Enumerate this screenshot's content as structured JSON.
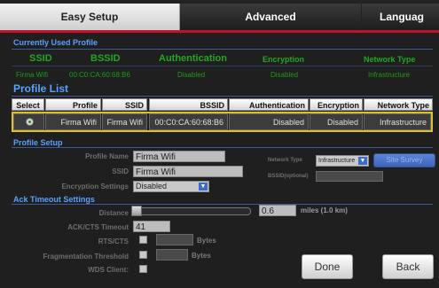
{
  "tabs": {
    "easy": "Easy Setup",
    "advanced": "Advanced",
    "language": "Languag"
  },
  "current": {
    "title": "Currently Used Profile",
    "headers": [
      "SSID",
      "BSSID",
      "Authentication",
      "Encryption",
      "Network Type"
    ],
    "values": [
      "Firma Wifi",
      "00:C0:CA:60:68:B6",
      "Disabled",
      "Disabled",
      "Infrastructure"
    ]
  },
  "profile_list": {
    "title": "Profile List",
    "headers": [
      "Select",
      "Profile",
      "SSID",
      "BSSID",
      "Authentication",
      "Encryption",
      "Network Type"
    ],
    "row": {
      "profile": "Firma Wifi",
      "ssid": "Firma Wifi",
      "bssid": "00:C0:CA:60:68:B6",
      "auth": "Disabled",
      "enc": "Disabled",
      "type": "Infrastructure"
    }
  },
  "profile_setup": {
    "title": "Profile Setup",
    "profile_name_label": "Profile Name",
    "profile_name": "Firma Wifi",
    "ssid_label": "SSID",
    "ssid": "Firma Wifi",
    "encryption_label": "Encryption Settings",
    "encryption": "Disabled",
    "network_type_label": "Network Type",
    "network_type": "Infrastructure",
    "site_survey": "Site Survey",
    "bssid_label": "BSSID(optional)",
    "bssid": ""
  },
  "ack": {
    "title": "Ack Timeout Settings",
    "distance_label": "Distance",
    "distance_value": "0.6",
    "distance_unit": "miles (1.0 km)",
    "timeout_label": "ACK/CTS Timeout",
    "timeout_value": "41",
    "rts_label": "RTS/CTS",
    "rts_unit": "Bytes",
    "frag_label": "Fragmentation Threshold",
    "frag_unit": "Bytes",
    "wds_label": "WDS Client:"
  },
  "buttons": {
    "done": "Done",
    "back": "Back"
  },
  "colors": {
    "accent_red": "#c8102e",
    "section_blue": "#5aa0ff",
    "green": "#1f9a1f",
    "highlight": "#e1c11f"
  }
}
